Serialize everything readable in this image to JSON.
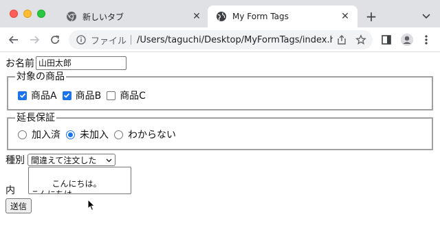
{
  "browser": {
    "tabs": [
      {
        "title": "新しいタブ",
        "close": "✕",
        "active": false
      },
      {
        "title": "My Form Tags",
        "close": "✕",
        "active": true
      }
    ],
    "new_tab_label": "+",
    "address": {
      "scheme_label": "ファイル",
      "url": "/Users/taguchi/Desktop/MyFormTags/index.ht..."
    }
  },
  "form": {
    "name_label": "お名前",
    "name_value": "山田太郎",
    "products": {
      "legend": "対象の商品",
      "options": [
        {
          "label": "商品A",
          "checked": true
        },
        {
          "label": "商品B",
          "checked": true
        },
        {
          "label": "商品C",
          "checked": false
        }
      ]
    },
    "warranty": {
      "legend": "延長保証",
      "options": [
        {
          "label": "加入済",
          "checked": false
        },
        {
          "label": "未加入",
          "checked": true
        },
        {
          "label": "わからない",
          "checked": false
        }
      ]
    },
    "kind_label": "種別",
    "kind_selected": "間違えて注文した",
    "content_label": "内容",
    "content_value": "こんにちは。\nこんにちは。",
    "submit_label": "送信"
  },
  "colors": {
    "accent": "#1a73e8",
    "tabstrip": "#dfe1e5"
  }
}
